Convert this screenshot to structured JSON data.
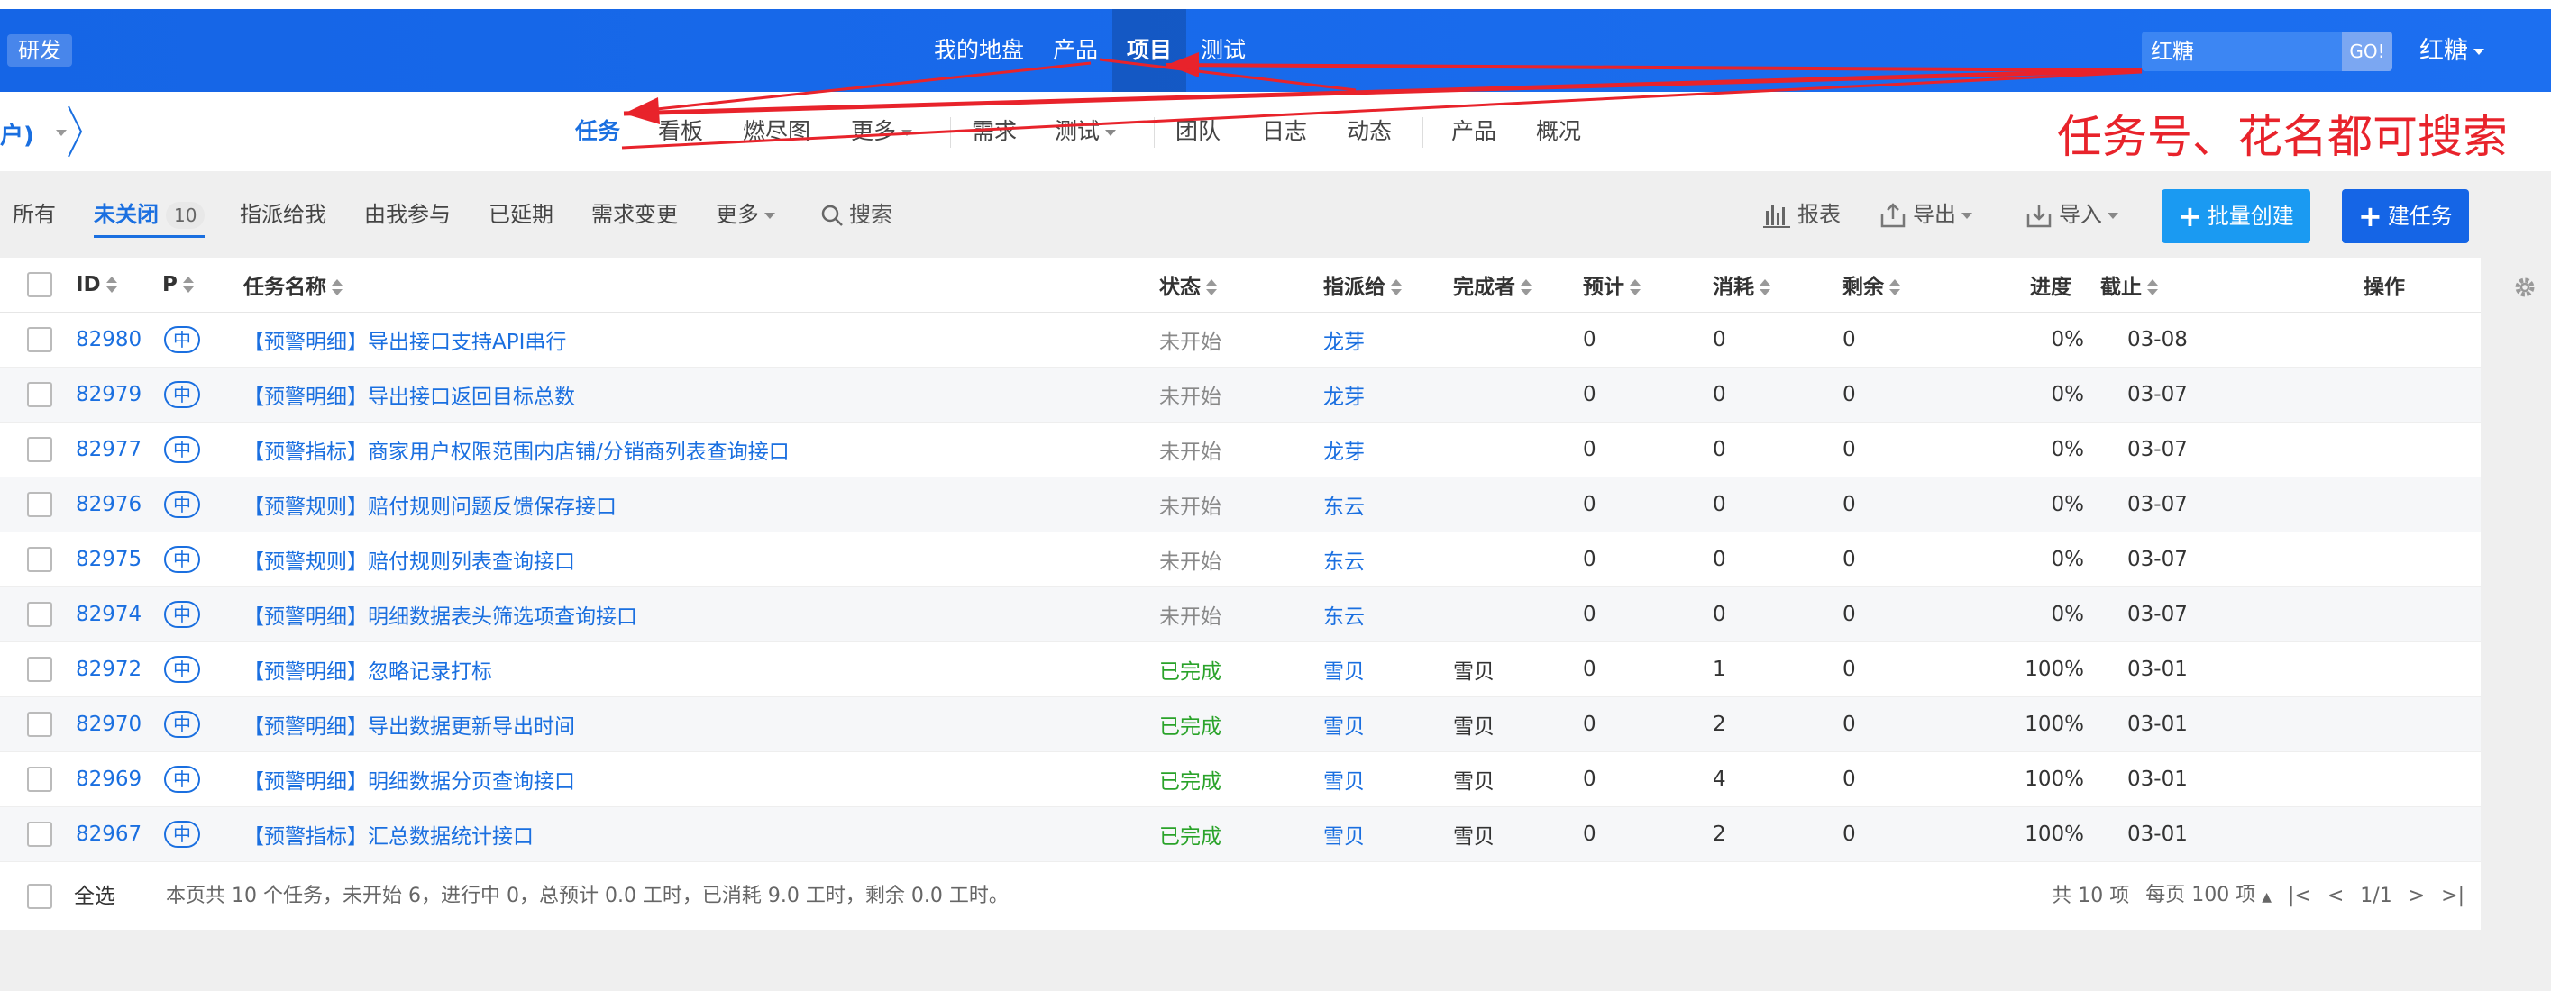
{
  "header": {
    "brand": "研发",
    "nav": [
      {
        "label": "我的地盘",
        "active": false
      },
      {
        "label": "产品",
        "active": false
      },
      {
        "label": "项目",
        "active": true
      },
      {
        "label": "测试",
        "active": false
      }
    ],
    "search_value": "红糖",
    "go_label": "GO!",
    "user": "红糖"
  },
  "subnav": {
    "project_fragment": "户)",
    "items": [
      "任务",
      "看板",
      "燃尽图",
      "更多",
      "需求",
      "测试",
      "团队",
      "日志",
      "动态",
      "产品",
      "概况"
    ],
    "active": "任务"
  },
  "annotation": "任务号、花名都可搜索",
  "toolbar": {
    "tabs": [
      "所有",
      "未关闭",
      "指派给我",
      "由我参与",
      "已延期",
      "需求变更",
      "更多"
    ],
    "active_tab": "未关闭",
    "unclosed_count": "10",
    "search_label": "搜索",
    "report_label": "报表",
    "export_label": "导出",
    "import_label": "导入",
    "batch_create_label": "批量创建",
    "create_label": "建任务"
  },
  "table": {
    "columns": {
      "id": "ID",
      "pri": "P",
      "name": "任务名称",
      "status": "状态",
      "assigned": "指派给",
      "finisher": "完成者",
      "estimate": "预计",
      "consumed": "消耗",
      "left": "剩余",
      "progress": "进度",
      "deadline": "截止",
      "actions": "操作"
    },
    "rows": [
      {
        "id": "82980",
        "pri": "中",
        "name": "【预警明细】导出接口支持API串行",
        "status": "未开始",
        "assigned": "龙芽",
        "finisher": "",
        "estimate": "0",
        "consumed": "0",
        "left": "0",
        "progress": "0%",
        "deadline": "03-08"
      },
      {
        "id": "82979",
        "pri": "中",
        "name": "【预警明细】导出接口返回目标总数",
        "status": "未开始",
        "assigned": "龙芽",
        "finisher": "",
        "estimate": "0",
        "consumed": "0",
        "left": "0",
        "progress": "0%",
        "deadline": "03-07"
      },
      {
        "id": "82977",
        "pri": "中",
        "name": "【预警指标】商家用户权限范围内店铺/分销商列表查询接口",
        "status": "未开始",
        "assigned": "龙芽",
        "finisher": "",
        "estimate": "0",
        "consumed": "0",
        "left": "0",
        "progress": "0%",
        "deadline": "03-07"
      },
      {
        "id": "82976",
        "pri": "中",
        "name": "【预警规则】赔付规则问题反馈保存接口",
        "status": "未开始",
        "assigned": "东云",
        "finisher": "",
        "estimate": "0",
        "consumed": "0",
        "left": "0",
        "progress": "0%",
        "deadline": "03-07"
      },
      {
        "id": "82975",
        "pri": "中",
        "name": "【预警规则】赔付规则列表查询接口",
        "status": "未开始",
        "assigned": "东云",
        "finisher": "",
        "estimate": "0",
        "consumed": "0",
        "left": "0",
        "progress": "0%",
        "deadline": "03-07"
      },
      {
        "id": "82974",
        "pri": "中",
        "name": "【预警明细】明细数据表头筛选项查询接口",
        "status": "未开始",
        "assigned": "东云",
        "finisher": "",
        "estimate": "0",
        "consumed": "0",
        "left": "0",
        "progress": "0%",
        "deadline": "03-07"
      },
      {
        "id": "82972",
        "pri": "中",
        "name": "【预警明细】忽略记录打标",
        "status": "已完成",
        "assigned": "雪贝",
        "finisher": "雪贝",
        "estimate": "0",
        "consumed": "1",
        "left": "0",
        "progress": "100%",
        "deadline": "03-01"
      },
      {
        "id": "82970",
        "pri": "中",
        "name": "【预警明细】导出数据更新导出时间",
        "status": "已完成",
        "assigned": "雪贝",
        "finisher": "雪贝",
        "estimate": "0",
        "consumed": "2",
        "left": "0",
        "progress": "100%",
        "deadline": "03-01"
      },
      {
        "id": "82969",
        "pri": "中",
        "name": "【预警明细】明细数据分页查询接口",
        "status": "已完成",
        "assigned": "雪贝",
        "finisher": "雪贝",
        "estimate": "0",
        "consumed": "4",
        "left": "0",
        "progress": "100%",
        "deadline": "03-01"
      },
      {
        "id": "82967",
        "pri": "中",
        "name": "【预警指标】汇总数据统计接口",
        "status": "已完成",
        "assigned": "雪贝",
        "finisher": "雪贝",
        "estimate": "0",
        "consumed": "2",
        "left": "0",
        "progress": "100%",
        "deadline": "03-01"
      }
    ]
  },
  "footer": {
    "select_all": "全选",
    "summary": "本页共 10 个任务，未开始 6，进行中 0，总预计 0.0 工时，已消耗 9.0 工时，剩余 0.0 工时。",
    "total": "共 10 项",
    "per_page": "每页 100 项",
    "page": "1/1"
  },
  "colors": {
    "header_blue": "#1565e6",
    "accent": "#1a6fe0",
    "done_green": "#2aa32a",
    "annotation_red": "#e8232b",
    "batch_button": "#1a9af2",
    "create_button": "#1565e6"
  }
}
